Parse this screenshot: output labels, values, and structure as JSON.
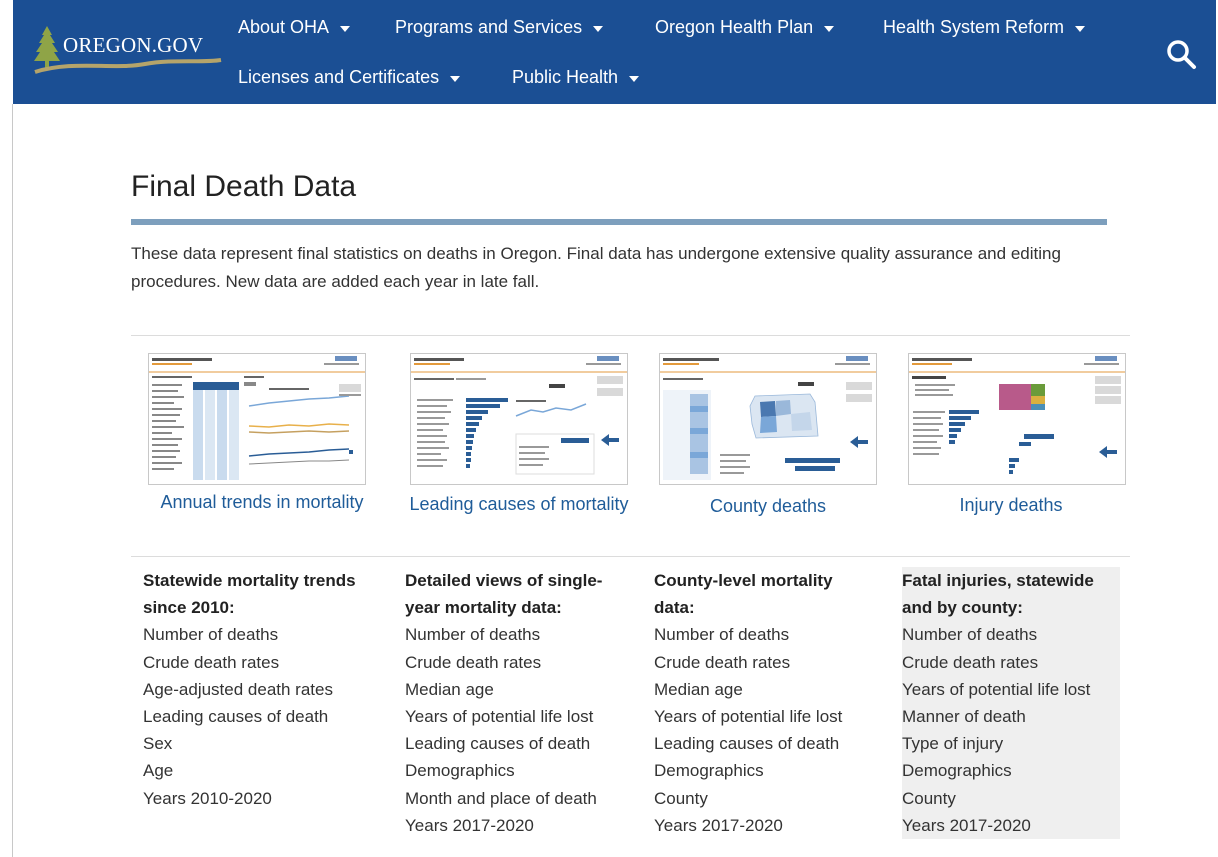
{
  "header": {
    "logo_text": "OREGON.GOV",
    "nav": [
      {
        "label": "About OHA"
      },
      {
        "label": "Programs and Services"
      },
      {
        "label": "Oregon Health Plan"
      },
      {
        "label": "Health System Reform"
      },
      {
        "label": "Licenses and Certificates"
      },
      {
        "label": "Public Health"
      }
    ],
    "search_icon": "search-icon"
  },
  "page": {
    "title": "Final Death Data",
    "intro": "These data represent final statistics on deaths in Oregon. Final data has undergone extensive quality assurance and editing procedures. New data are added each year in late fall."
  },
  "dashboards": [
    {
      "label": "Annual trends in mortality"
    },
    {
      "label": "Leading causes of mortality"
    },
    {
      "label": "County deaths"
    },
    {
      "label": "Injury deaths"
    }
  ],
  "columns": [
    {
      "heading": "Statewide mortality trends since 2010:",
      "items": [
        "Number of deaths",
        "Crude death rates",
        "Age-adjusted death rates",
        "Leading causes of death",
        "Sex",
        "Age",
        "Years 2010-2020"
      ]
    },
    {
      "heading": "Detailed views of single-year mortality data:",
      "items": [
        "Number of deaths",
        "Crude death rates",
        "Median age",
        "Years of potential life lost",
        "Leading causes of death",
        "Demographics",
        "Month and place of death",
        "Years 2017-2020"
      ]
    },
    {
      "heading": "County-level mortality data:",
      "items": [
        "Number of deaths",
        "Crude death rates",
        "Median age",
        "Years of potential life lost",
        "Leading causes of death",
        "Demographics",
        "County",
        "Years 2017-2020"
      ]
    },
    {
      "heading": "Fatal injuries, statewide and by county:",
      "items": [
        "Number of deaths",
        "Crude death rates",
        "Years of potential life lost",
        "Manner of death",
        "Type of injury",
        "Demographics",
        "County",
        "Years 2017-2020"
      ]
    }
  ],
  "colors": {
    "header_bg": "#1b4f94",
    "link": "#1f5c99",
    "title_rule": "#7d9fbd"
  }
}
